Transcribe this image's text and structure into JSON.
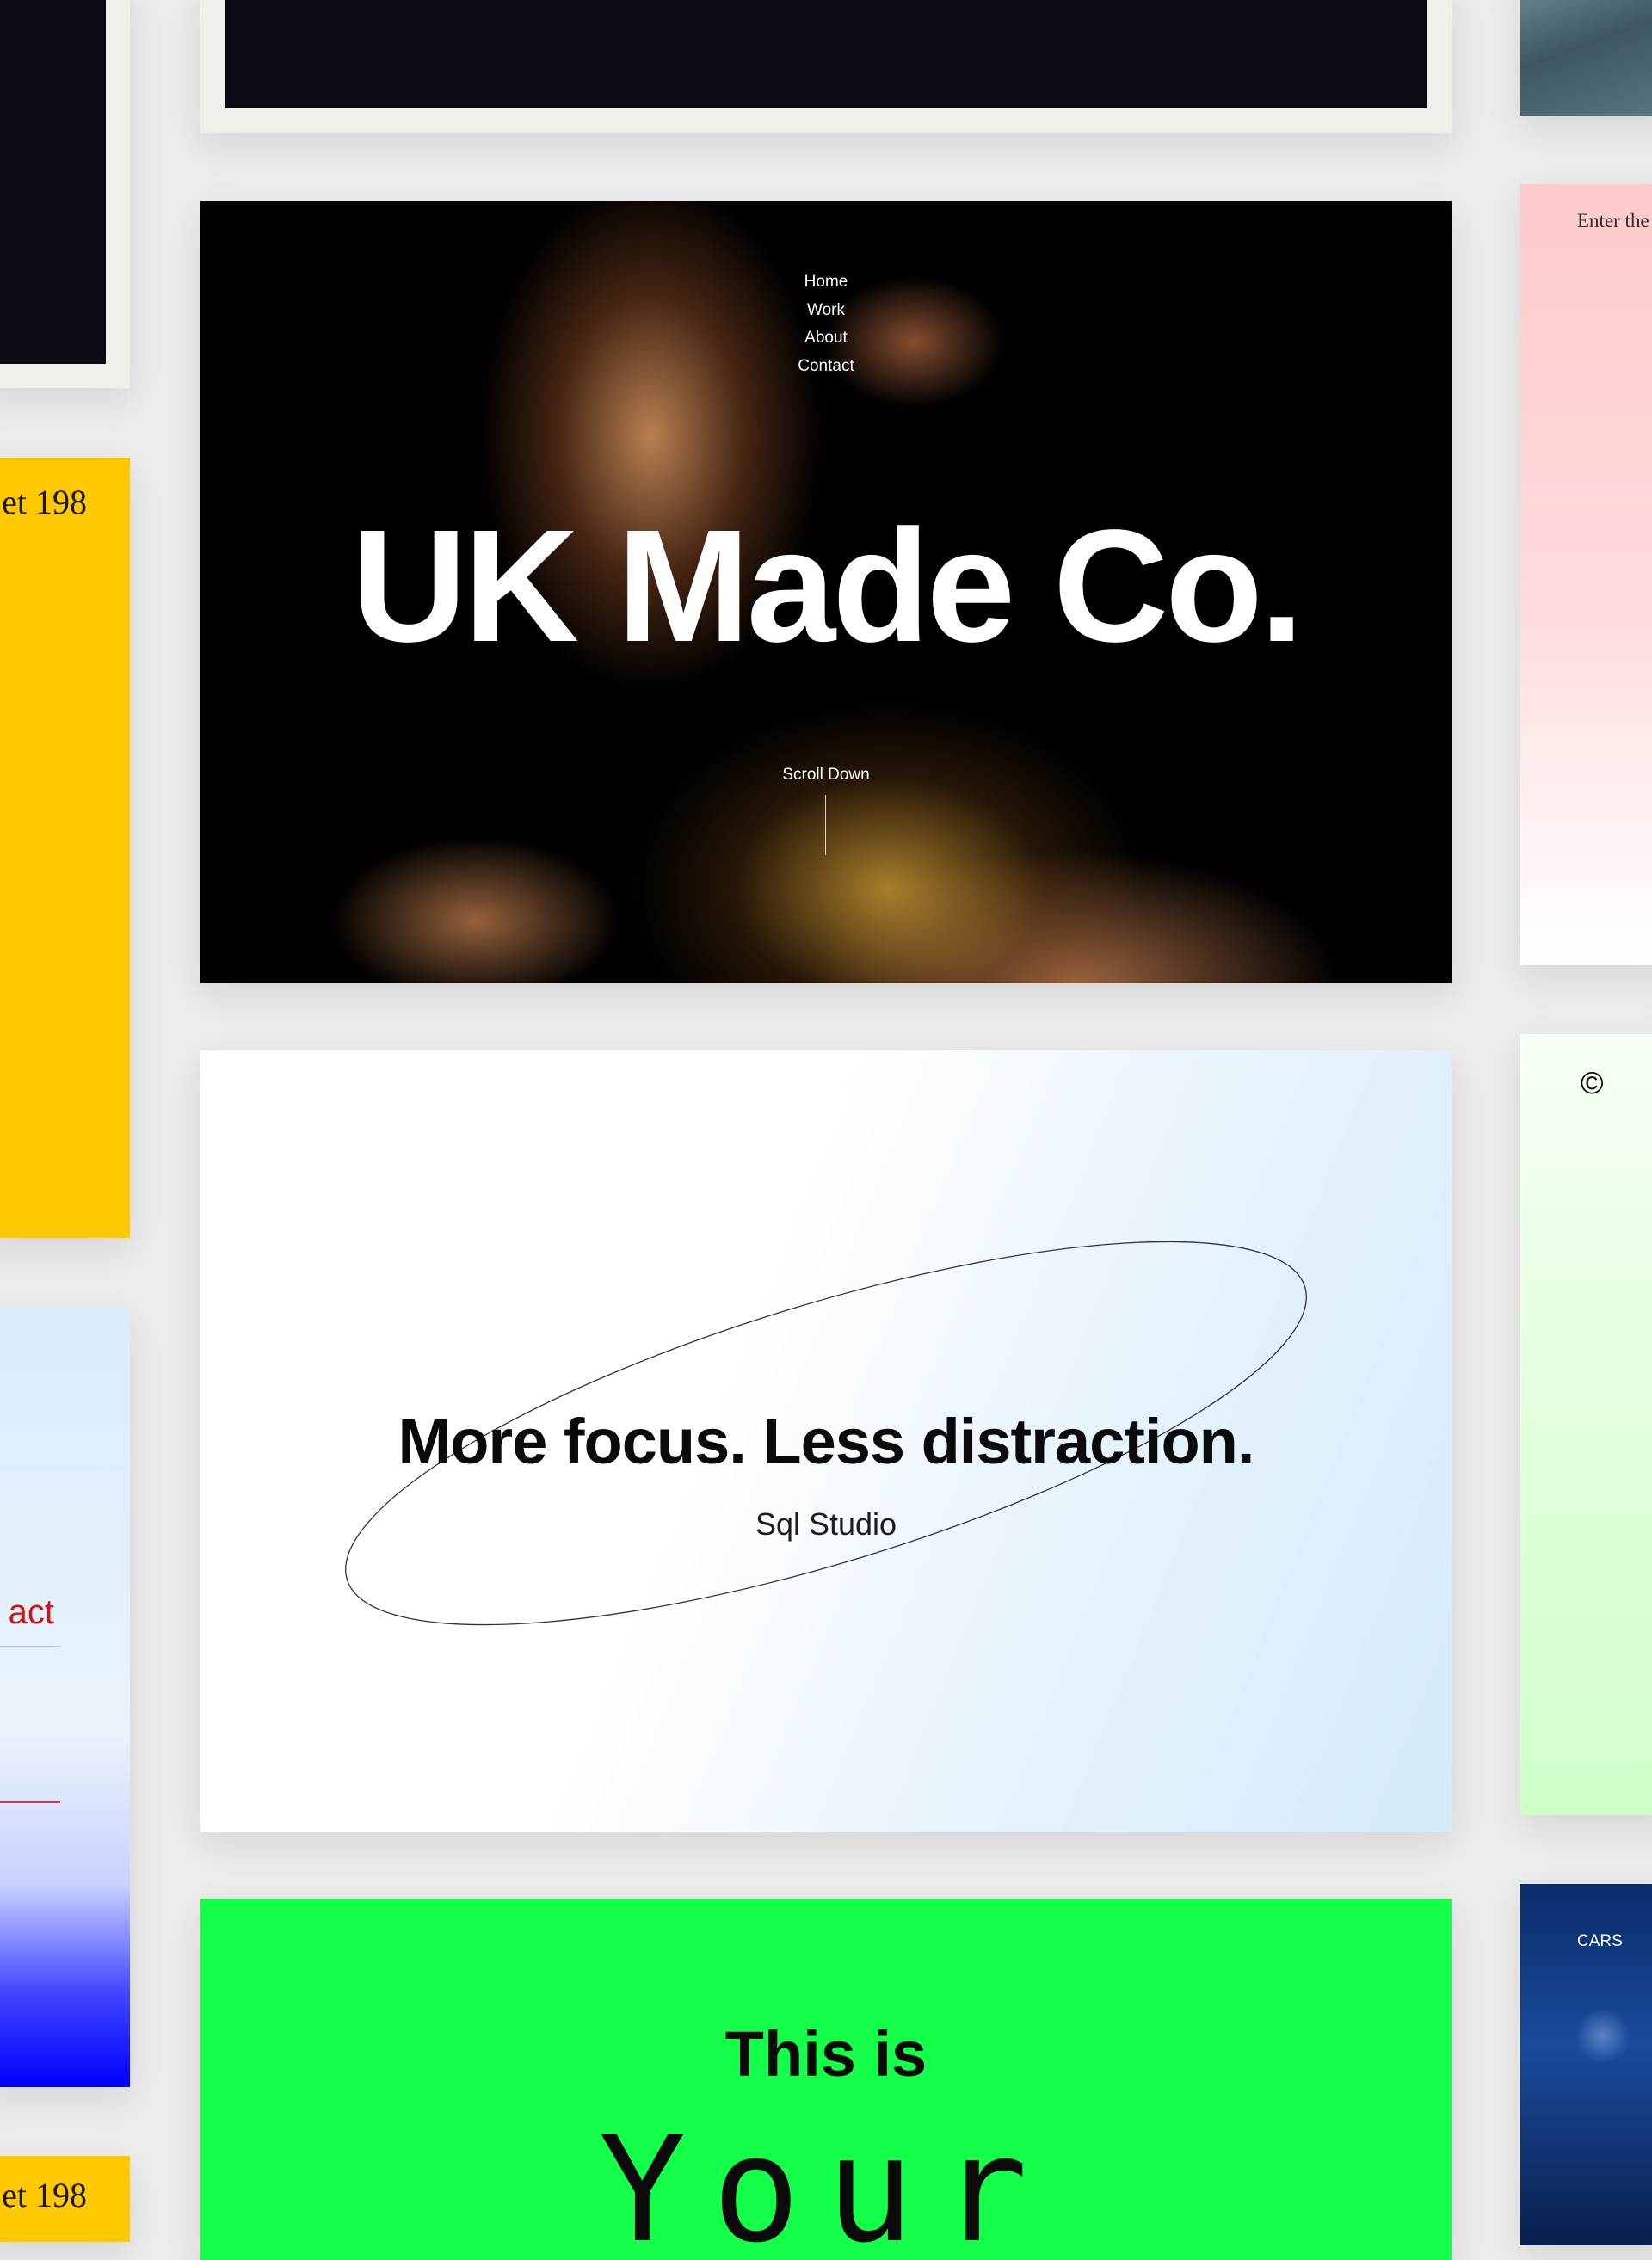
{
  "left_column": {
    "yellow_card_text": "et 198",
    "contact_label": "act",
    "yellow_card_2_text": "et 198"
  },
  "uk_made_card": {
    "nav": [
      "Home",
      "Work",
      "About",
      "Contact"
    ],
    "title": "UK Made Co.",
    "scroll_label": "Scroll Down"
  },
  "focus_card": {
    "headline": "More focus. Less distraction.",
    "studio": "Sql Studio"
  },
  "green_card": {
    "line1": "This is",
    "line2": "Your"
  },
  "right_column": {
    "pink_card_text": "Enter the",
    "copyright_symbol": "©",
    "cars_label": "CARS"
  },
  "colors": {
    "background": "#ececec",
    "yellow": "#ffc800",
    "green": "#14ff4a",
    "red_text": "#d21414",
    "dark": "#0a0a12"
  }
}
